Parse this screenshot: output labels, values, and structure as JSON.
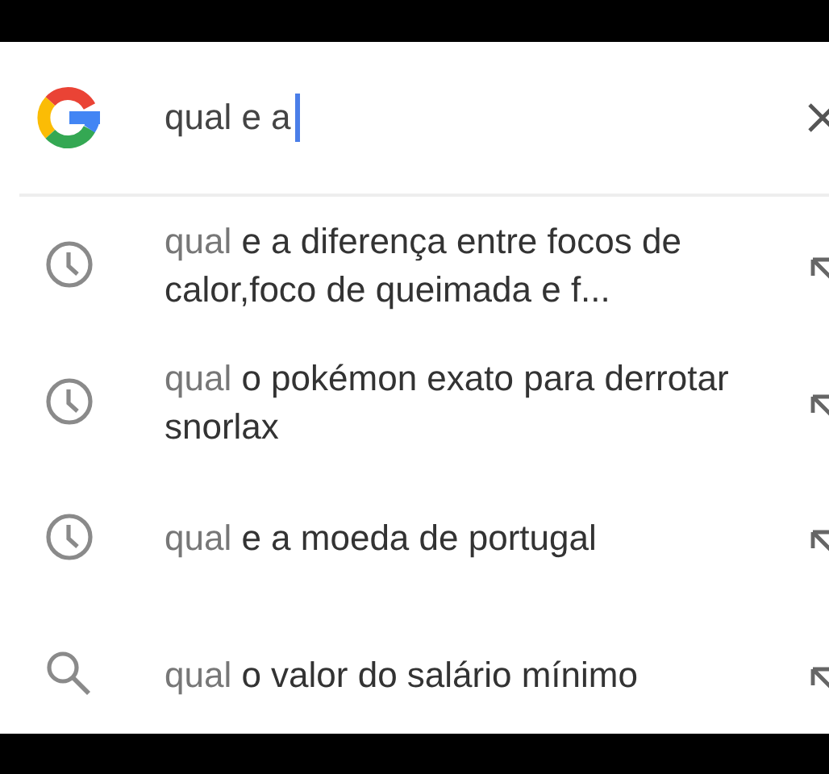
{
  "search": {
    "value": "qual e a",
    "focused": true
  },
  "suggestions": [
    {
      "kind": "history",
      "prefix": "qual",
      "rest": " e a diferença entre focos de calor,foco de queimada e f..."
    },
    {
      "kind": "history",
      "prefix": "qual",
      "rest": " o pokémon exato para derrotar snorlax"
    },
    {
      "kind": "history",
      "prefix": "qual",
      "rest": " e a moeda de portugal"
    },
    {
      "kind": "search",
      "prefix": "qual",
      "rest": " o valor do salário mínimo"
    }
  ]
}
